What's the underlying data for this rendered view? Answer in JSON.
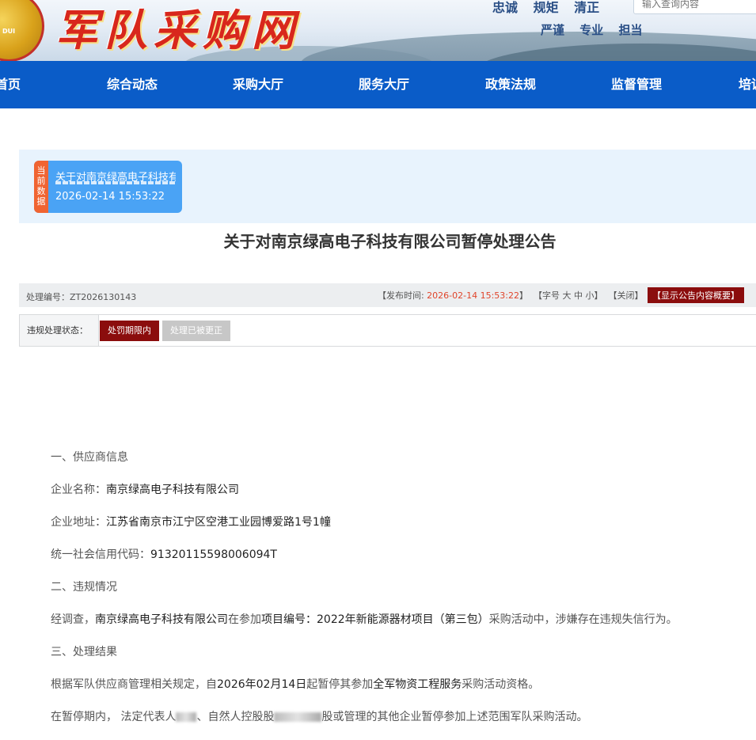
{
  "header": {
    "site_logo_text": "军队采购网",
    "motto_line1": "忠诚 规矩 清正",
    "motto_line2": "严谨 专业 担当",
    "search_placeholder": "输入查询内容"
  },
  "nav": {
    "items": [
      "首页",
      "综合动态",
      "采购大厅",
      "服务大厅",
      "政策法规",
      "监督管理",
      "培训"
    ]
  },
  "current_data": {
    "tag": "当前数据",
    "title": "关于对南京绿高电子科技有限公司暂停处理公告",
    "time": "2026-02-14 15:53:22"
  },
  "notice": {
    "title": "关于对南京绿高电子科技有限公司暂停处理公告",
    "id_label": "处理编号：",
    "id_value": "ZT2026130143",
    "publish_prefix": "【发布时间: ",
    "publish_time": "2026-02-14 15:53:22",
    "publish_suffix": "】",
    "font_size_prefix": "【字号",
    "font_large": "大",
    "font_medium": "中",
    "font_small": "小",
    "font_size_suffix": "】",
    "close_label": "【关闭】",
    "summary_button": "【显示公告内容概要】",
    "status_label": "违规处理状态：",
    "status_active": "处罚期限内",
    "status_inactive": "处理已被更正"
  },
  "content": {
    "s1_heading": "一、供应商信息",
    "company_label": "企业名称：",
    "company_value": "南京绿高电子科技有限公司",
    "address_label": "企业地址：",
    "address_value": "江苏省南京市江宁区空港工业园博爱路1号1幢",
    "credit_label": "统一社会信用代码：",
    "credit_value": "91320115598006094T",
    "s2_heading": "二、违规情况",
    "violation_prefix": "经调查，",
    "violation_company": "南京绿高电子科技有限公司",
    "violation_mid": "在参加",
    "violation_project": "项目编号：2022年新能源器材项目（第三包）",
    "violation_suffix": "采购活动中，涉嫌存在违规失信行为。",
    "s3_heading": "三、处理结果",
    "result_prefix": "根据军队供应商管理相关规定，自",
    "result_date": "2026年02月14日",
    "result_mid": "起暂停其参加",
    "result_scope": "全军物资工程服务",
    "result_suffix": "采购活动资格。",
    "period_a": "在暂停期内， 法定代表人",
    "period_b": "、自然人控股股",
    "period_c": "股或管理的其他企业暂停参加上述范围军队采购活动。"
  }
}
